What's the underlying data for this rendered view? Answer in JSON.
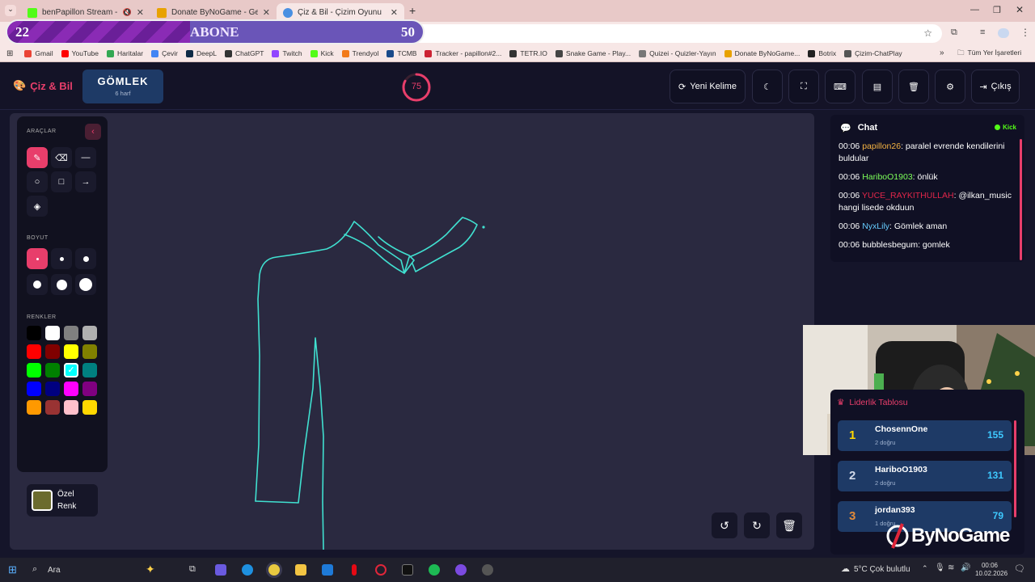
{
  "browser": {
    "tabs": [
      {
        "title": "benPapillon Stream - Watch",
        "favicon_color": "#53fc18"
      },
      {
        "title": "Donate ByNoGame - Gelen/Gid",
        "favicon_color": "#e8a200"
      },
      {
        "title": "Çiz & Bil - Çizim Oyunu",
        "favicon_color": "#4a90e2"
      }
    ],
    "new_tab": "+",
    "bookmarks": [
      {
        "label": "Gmail",
        "color": "#ea4335"
      },
      {
        "label": "YouTube",
        "color": "#ff0000"
      },
      {
        "label": "Haritalar",
        "color": "#34a853"
      },
      {
        "label": "Çevir",
        "color": "#4285f4"
      },
      {
        "label": "DeepL",
        "color": "#0f2b46"
      },
      {
        "label": "ChatGPT",
        "color": "#333333"
      },
      {
        "label": "Twitch",
        "color": "#9146ff"
      },
      {
        "label": "Kick",
        "color": "#53fc18"
      },
      {
        "label": "Trendyol",
        "color": "#f27a1a"
      },
      {
        "label": "TCMB",
        "color": "#1a4a8a"
      },
      {
        "label": "Tracker - papillon#2...",
        "color": "#cc2233"
      },
      {
        "label": "TETR.IO",
        "color": "#333333"
      },
      {
        "label": "Snake Game - Play...",
        "color": "#444444"
      },
      {
        "label": "Quizei - Quizler-Yayın",
        "color": "#777777"
      },
      {
        "label": "Donate ByNoGame...",
        "color": "#e8a200"
      },
      {
        "label": "Botrix",
        "color": "#222222"
      },
      {
        "label": "Çizim-ChatPlay",
        "color": "#555555"
      }
    ],
    "bookmarks_more": "»",
    "all_bookmarks": "Tüm Yer İşaretleri"
  },
  "sub_overlay": {
    "current": "22",
    "label": "ABONE",
    "goal": "50",
    "progress": 0.44
  },
  "app": {
    "logo": "Çiz & Bil",
    "word": "GÖMLEK",
    "word_hint": "6 harf",
    "timer": "75",
    "timer_fraction": 0.83,
    "new_word": "Yeni Kelime",
    "exit": "Çıkış"
  },
  "tools": {
    "tools_title": "ARAÇLAR",
    "size_title": "BOYUT",
    "colors_title": "RENKLER",
    "custom_color_label_1": "Özel",
    "custom_color_label_2": "Renk",
    "custom_color": "#6b6b2e",
    "palette": [
      "#000000",
      "#ffffff",
      "#808080",
      "#b0b0b0",
      "#ff0000",
      "#800000",
      "#ffff00",
      "#808000",
      "#00ff00",
      "#008000",
      "#00ffff",
      "#008080",
      "#0000ff",
      "#000080",
      "#ff00ff",
      "#800080",
      "#ff9900",
      "#993333",
      "#ffc0cb",
      "#ffd700"
    ],
    "selected_color": "#00ffff",
    "brush_color": "#40e0d0"
  },
  "chat": {
    "title": "Chat",
    "platform": "Kick",
    "messages": [
      {
        "time": "00:06",
        "user": "papillon26",
        "color": "#f5b342",
        "text": ": paralel evrende kendilerini buldular"
      },
      {
        "time": "00:06",
        "user": "HariboO1903",
        "color": "#7dff5a",
        "text": ": önlük"
      },
      {
        "time": "00:06",
        "user": "YUCE_RAYKITHULLAH",
        "color": "#e0264a",
        "text": ": @ilkan_music hangi lisede okduun"
      },
      {
        "time": "00:06",
        "user": "NyxLily",
        "color": "#66ccff",
        "text": ": Gömlek aman"
      },
      {
        "time": "00:06",
        "user": "bubblesbegum",
        "color": "#ffffff",
        "text": ": gomlek"
      }
    ]
  },
  "leaderboard": {
    "title": "Liderlik Tablosu",
    "rows": [
      {
        "rank": "1",
        "name": "ChosennOne",
        "detail": "2 doğru",
        "score": "155",
        "rank_color": "#ffd700"
      },
      {
        "rank": "2",
        "name": "HariboO1903",
        "detail": "2 doğru",
        "score": "131",
        "rank_color": "#d0d8e8"
      },
      {
        "rank": "3",
        "name": "jordan393",
        "detail": "1 doğru",
        "score": "79",
        "rank_color": "#e08a3a"
      }
    ]
  },
  "watermark": "ByNoGame",
  "taskbar": {
    "search": "Ara",
    "weather": "5°C  Çok bulutlu",
    "time": "00:06",
    "date": "10.02.2026"
  }
}
